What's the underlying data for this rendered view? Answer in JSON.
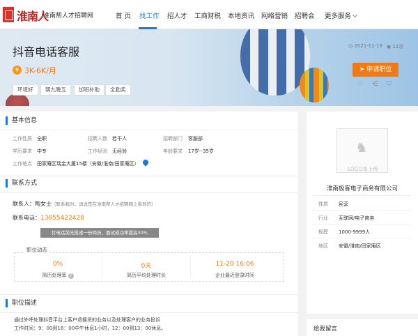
{
  "header": {
    "logo_text": "淮南人",
    "logo_subtitle": "淮南帮人才招聘网",
    "nav": [
      {
        "label": "首 页"
      },
      {
        "label": "找工作"
      },
      {
        "label": "招人才"
      },
      {
        "label": "工商财税"
      },
      {
        "label": "本地资讯"
      },
      {
        "label": "网络营销"
      },
      {
        "label": "招聘会"
      },
      {
        "label": "更多服务"
      }
    ],
    "active_nav": "找工作"
  },
  "job": {
    "title": "抖音电话客服",
    "salary": "3K-6K/月",
    "tags": [
      "环境好",
      "朝九晚五",
      "加班补助",
      "全勤奖"
    ],
    "date": "2021-11-19",
    "views": "11次",
    "apply_label": "申请职位"
  },
  "basic_info": {
    "heading": "基本信息",
    "rows": [
      [
        {
          "label": "工作性质",
          "value": "全职"
        },
        {
          "label": "招聘人数",
          "value": "若干人"
        },
        {
          "label": "招聘部门",
          "value": "客服部"
        }
      ],
      [
        {
          "label": "学历要求",
          "value": "中专"
        },
        {
          "label": "工作经验",
          "value": "无经验"
        },
        {
          "label": "年龄要求",
          "value": "17岁--35岁"
        }
      ]
    ],
    "address_label": "工作地点",
    "address": "田家庵区瑞金大厦15楼（安徽/淮南/田家庵区）"
  },
  "contact": {
    "heading": "联系方式",
    "person_label": "联系人：",
    "person": "陶女士",
    "person_note": "（联系我时，请说是在淮南帮人才招聘网上看到的）",
    "phone_label": "联系电话：",
    "phone": "13855422428",
    "tip": "打电话前先投递一份简历，面试成功率提高30%"
  },
  "dynamics": {
    "heading": "职位动态",
    "stats": [
      {
        "value": "0%",
        "label": "简历处理率",
        "has_help": true
      },
      {
        "value": "0天",
        "label": "简历平均处理时长"
      },
      {
        "value": "11-20 16:06",
        "label": "企业最近登录时间"
      }
    ]
  },
  "description": {
    "heading": "职位描述",
    "lines": [
      "通过外呼处理抖音平台上客户退换货的业务以及处理客户的业务投诉",
      "工作时间：9：00到18：00中午休息1小时，12：00到13：00休息。"
    ]
  },
  "company": {
    "logo_placeholder": "LOGO未上传",
    "name": "淮南极客电子商务有限公司",
    "rows": [
      {
        "label": "性质",
        "value": "民营"
      },
      {
        "label": "行业",
        "value": "互联网/电子商务"
      },
      {
        "label": "规模",
        "value": "1000-9999人"
      },
      {
        "label": "地区",
        "value": "安徽/淮南/田家庵区"
      }
    ]
  },
  "message": {
    "heading": "给我留言"
  },
  "colors": {
    "accent": "#1a78d6",
    "orange": "#f07b16"
  }
}
